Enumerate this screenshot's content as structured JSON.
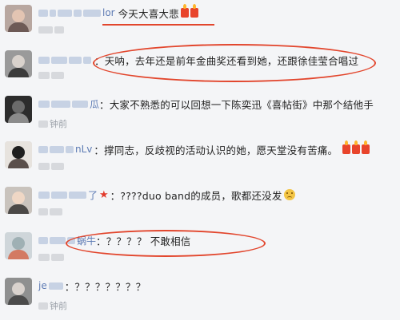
{
  "comments": [
    {
      "user": "lor",
      "text": "今天大喜大悲",
      "time": "",
      "emoji": "candles-2"
    },
    {
      "user": "",
      "text": "：天呐，去年还是前年金曲奖还看到她，还跟徐佳莹合唱过",
      "time": "",
      "emoji": ""
    },
    {
      "user": "瓜",
      "text": "：大家不熟悉的可以回想一下陈奕迅《喜帖街》中那个结他手",
      "time": "钟前",
      "emoji": ""
    },
    {
      "user": "nLv",
      "text": "：撑同志，反歧视的活动认识的她，愿天堂没有苦痛。",
      "time": "",
      "emoji": "candles-3"
    },
    {
      "user": "了",
      "text": "：????duo band的成员，歌都还没发",
      "time": "",
      "emoji": "sad-face"
    },
    {
      "user": "蜗牛",
      "text": "：？？？？ 不敢相信",
      "time": "",
      "emoji": ""
    },
    {
      "user": "je",
      "text": "：？？？？？？？",
      "time": "钟前",
      "emoji": ""
    }
  ],
  "colors": {
    "annotation": "#e2462d",
    "username": "#5d7bb4"
  },
  "icons": {
    "candle": "candle-icon",
    "star": "star-icon",
    "sad": "sad-face-icon"
  }
}
